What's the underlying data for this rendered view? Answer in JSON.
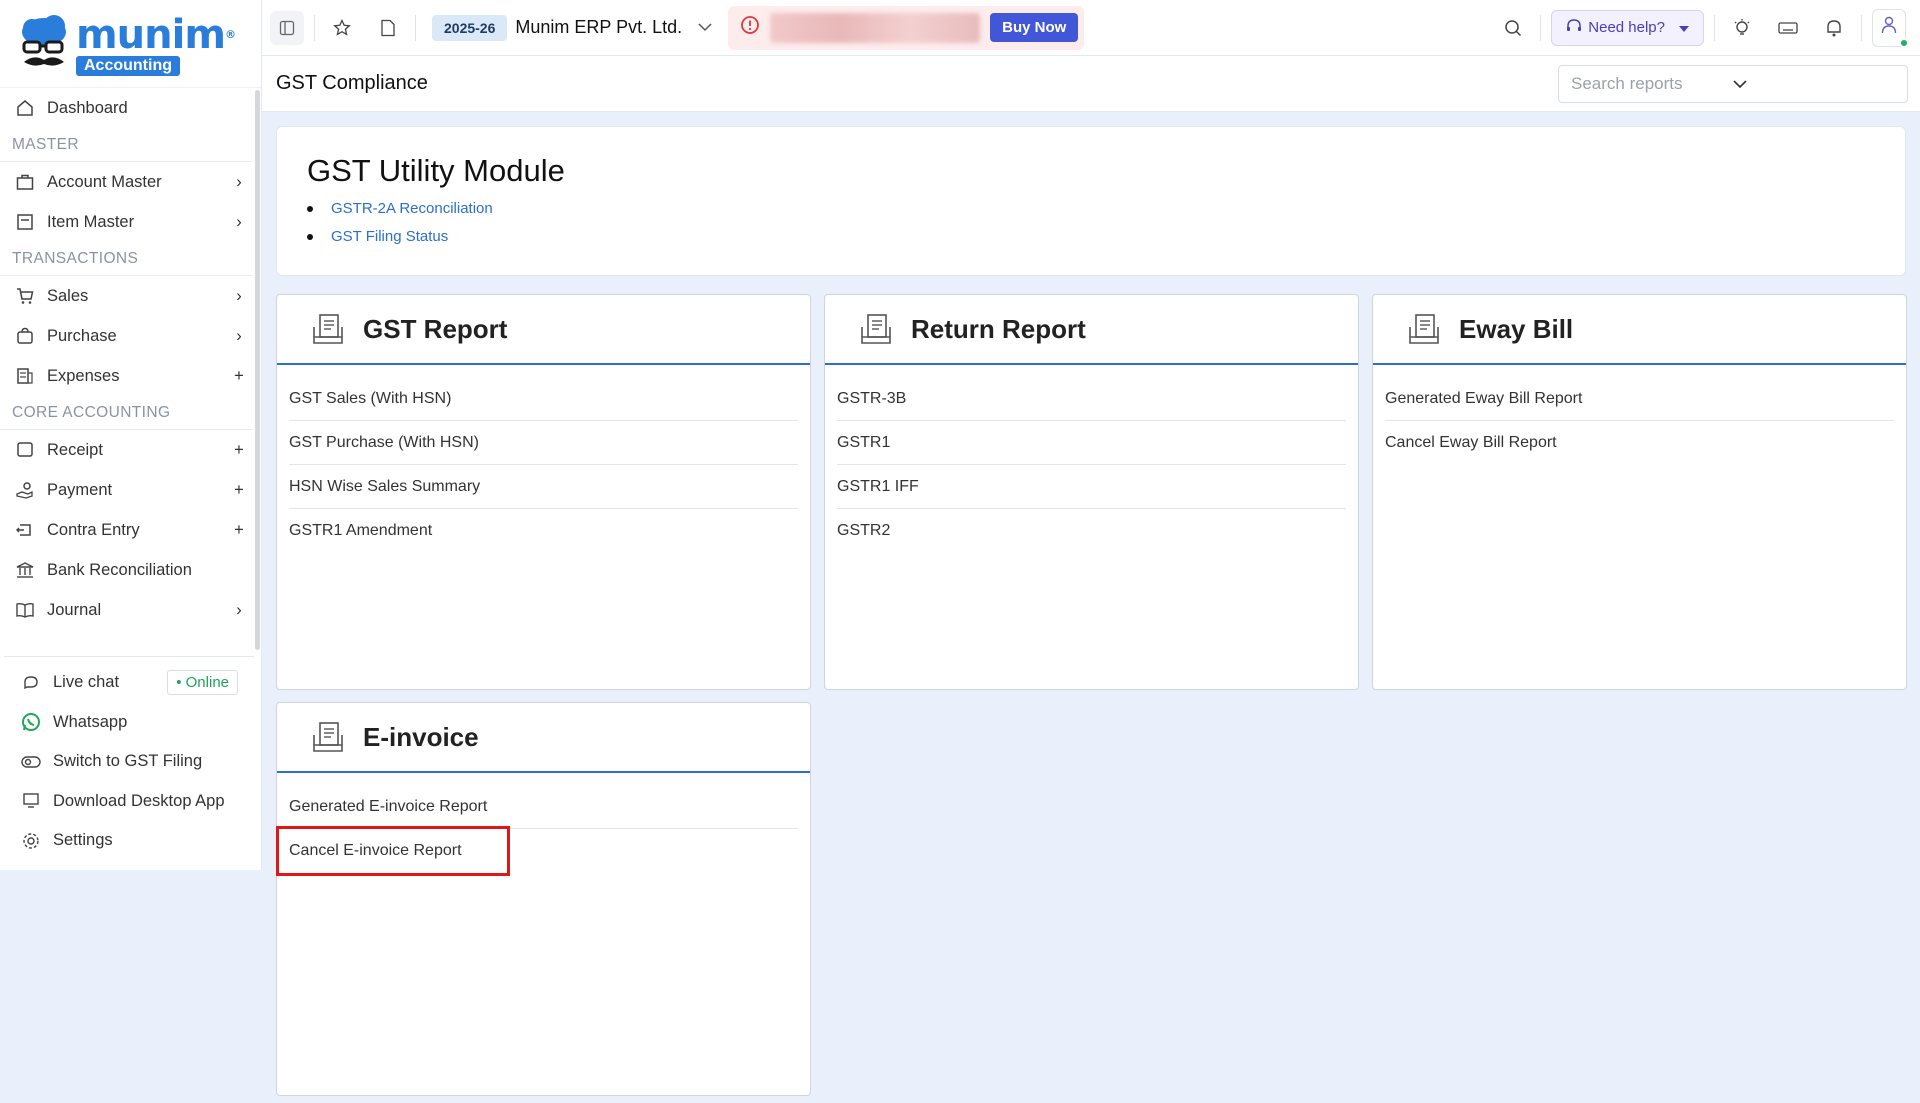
{
  "brand": {
    "name": "munim",
    "sub": "Accounting",
    "reg": "®"
  },
  "sidebar": {
    "items": [
      {
        "label": "Dashboard"
      }
    ],
    "sections": {
      "master": "MASTER",
      "transactions": "TRANSACTIONS",
      "core": "CORE ACCOUNTING"
    },
    "master_items": [
      {
        "label": "Account Master",
        "trail": "chevron"
      },
      {
        "label": "Item Master",
        "trail": "chevron"
      }
    ],
    "transaction_items": [
      {
        "label": "Sales",
        "trail": "chevron"
      },
      {
        "label": "Purchase",
        "trail": "chevron"
      },
      {
        "label": "Expenses",
        "trail": "plus"
      }
    ],
    "core_items": [
      {
        "label": "Receipt",
        "trail": "plus"
      },
      {
        "label": "Payment",
        "trail": "plus"
      },
      {
        "label": "Contra Entry",
        "trail": "plus"
      },
      {
        "label": "Bank Reconciliation",
        "trail": ""
      },
      {
        "label": "Journal",
        "trail": "chevron"
      }
    ],
    "bottom": {
      "live_chat": "Live chat",
      "online": "• Online",
      "whatsapp": "Whatsapp",
      "switch": "Switch to GST Filing",
      "download": "Download Desktop App",
      "settings": "Settings"
    }
  },
  "topbar": {
    "year": "2025-26",
    "company": "Munim ERP Pvt. Ltd.",
    "buy_now": "Buy Now",
    "need_help": "Need help?"
  },
  "subheader": {
    "title": "GST Compliance",
    "search_placeholder": "Search reports"
  },
  "utility": {
    "title": "GST Utility Module",
    "links": [
      "GSTR-2A Reconciliation",
      "GST Filing Status"
    ]
  },
  "cards": {
    "gst": {
      "title": "GST Report",
      "rows": [
        "GST Sales (With HSN)",
        "GST Purchase (With HSN)",
        "HSN Wise Sales Summary",
        "GSTR1 Amendment"
      ]
    },
    "return": {
      "title": "Return Report",
      "rows": [
        "GSTR-3B",
        "GSTR1",
        "GSTR1 IFF",
        "GSTR2"
      ]
    },
    "eway": {
      "title": "Eway Bill",
      "rows": [
        "Generated Eway Bill Report",
        "Cancel Eway Bill Report"
      ]
    },
    "einvoice": {
      "title": "E-invoice",
      "rows": [
        "Generated E-invoice Report",
        "Cancel E-invoice Report"
      ]
    }
  },
  "colors": {
    "accent": "#2b6fcf",
    "brand": "#2b7ddb",
    "highlight": "#e01717",
    "buy": "#4257d8"
  }
}
